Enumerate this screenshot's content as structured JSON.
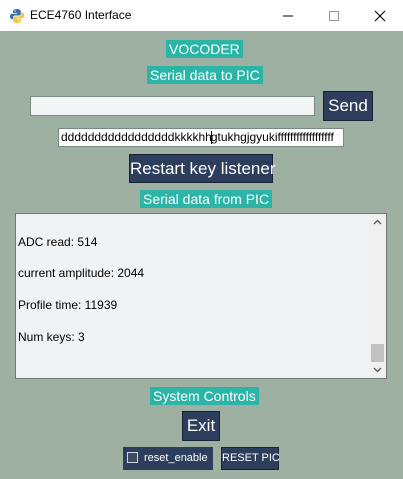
{
  "window": {
    "title": "ECE4760 Interface",
    "minimize_icon": "minimize-icon",
    "maximize_icon": "maximize-icon",
    "close_icon": "close-icon"
  },
  "labels": {
    "vocoder": "VOCODER",
    "serial_to_pic": "Serial data to PIC",
    "serial_from_pic": "Serial data from PIC",
    "system_controls": "System Controls"
  },
  "serial_out": {
    "value": "",
    "send_label": "Send"
  },
  "key_input": {
    "text_before_caret": "dddddddddddddddddkkkkhh",
    "text_after_caret": "gtukhgjgyukiffffffffffffffffff"
  },
  "buttons": {
    "restart_key_listener": "Restart key listener",
    "exit": "Exit",
    "reset_pic": "RESET PIC"
  },
  "output_lines": [
    "ADC read: 514",
    "current amplitude: 2044",
    "Profile time: 11939",
    "Num keys: 3"
  ],
  "reset_enable": {
    "label": "reset_enable",
    "checked": false
  },
  "colors": {
    "background": "#9DB0A2",
    "label_accent": "#2CB5A7",
    "button_dark": "#2C3E5C"
  }
}
